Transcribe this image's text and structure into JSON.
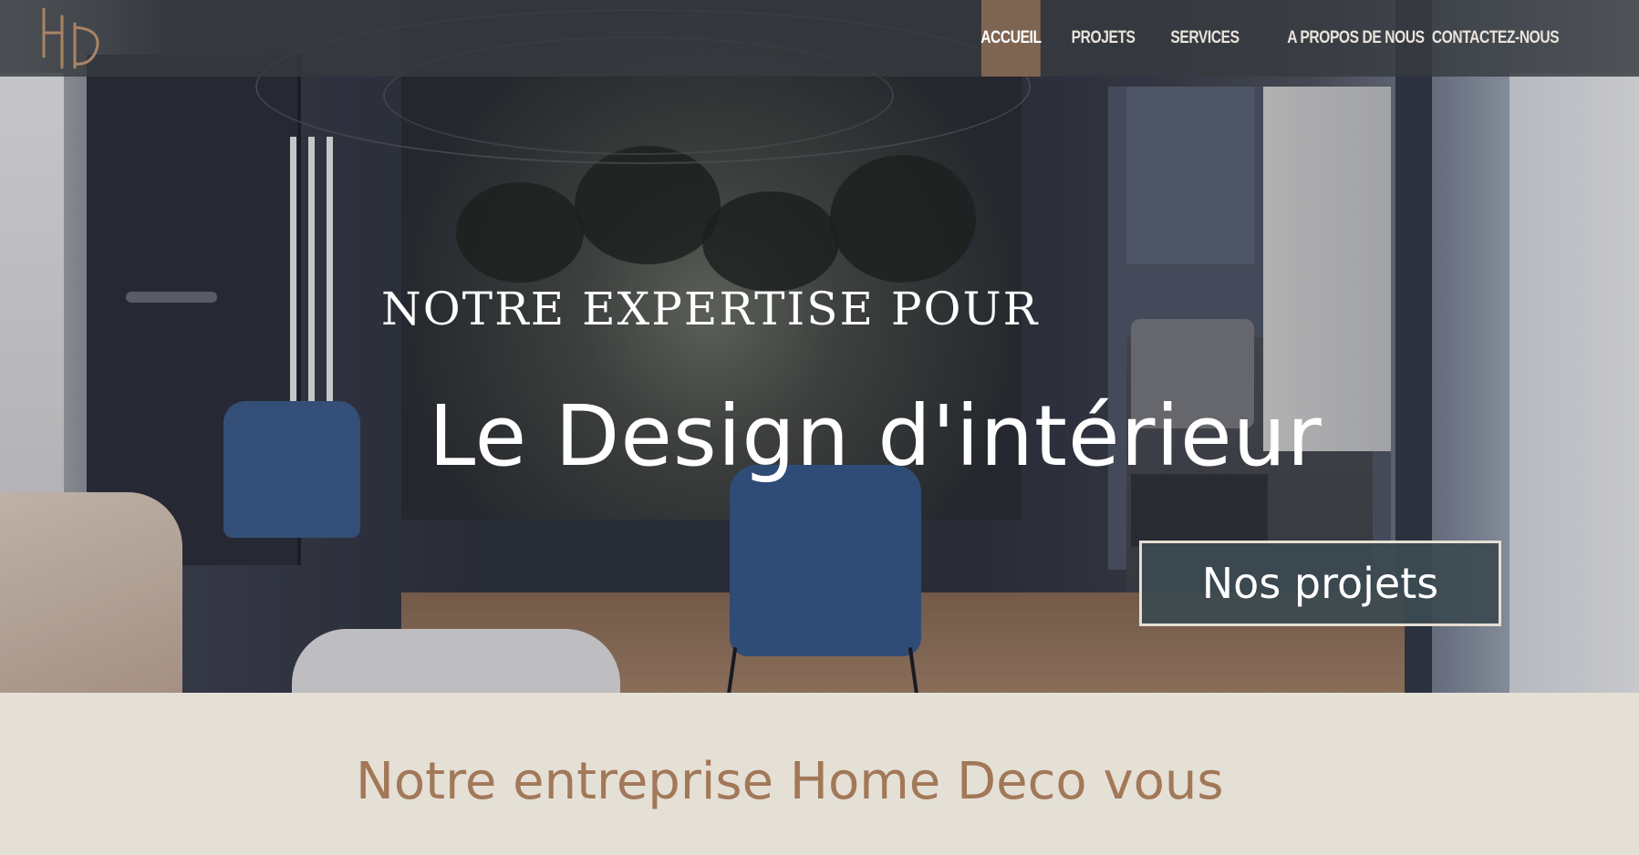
{
  "header": {
    "logo_text": "HD",
    "nav": [
      {
        "label": "ACCUEIL",
        "active": true
      },
      {
        "label": "PROJETS",
        "active": false
      },
      {
        "label": "SERVICES",
        "active": false
      },
      {
        "label": "A PROPOS DE NOUS",
        "active": false
      },
      {
        "label": "CONTACTEZ-NOUS",
        "active": false
      }
    ]
  },
  "hero": {
    "kicker": "NOTRE EXPERTISE POUR",
    "title": "Le Design d'intérieur",
    "cta_label": "Nos projets"
  },
  "intro": {
    "title": "Notre entreprise Home Deco vous"
  },
  "colors": {
    "accent": "#7e6552",
    "heading_brown": "#a27859",
    "section_bg": "#e5e0d6",
    "header_bg": "#373a40"
  }
}
